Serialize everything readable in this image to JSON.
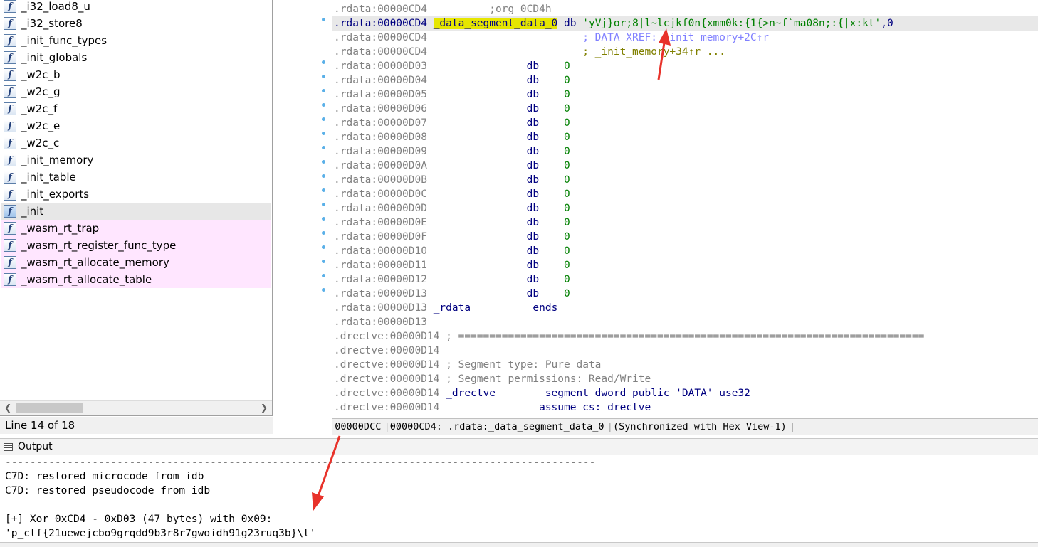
{
  "functions": {
    "items": [
      {
        "label": "_i32_load8_u",
        "style": "normal"
      },
      {
        "label": "_i32_store8",
        "style": "normal"
      },
      {
        "label": "_init_func_types",
        "style": "normal"
      },
      {
        "label": "_init_globals",
        "style": "normal"
      },
      {
        "label": "_w2c_b",
        "style": "normal"
      },
      {
        "label": "_w2c_g",
        "style": "normal"
      },
      {
        "label": "_w2c_f",
        "style": "normal"
      },
      {
        "label": "_w2c_e",
        "style": "normal"
      },
      {
        "label": "_w2c_c",
        "style": "normal"
      },
      {
        "label": "_init_memory",
        "style": "normal"
      },
      {
        "label": "_init_table",
        "style": "normal"
      },
      {
        "label": "_init_exports",
        "style": "normal"
      },
      {
        "label": "_init",
        "style": "selected"
      },
      {
        "label": "_wasm_rt_trap",
        "style": "import"
      },
      {
        "label": "_wasm_rt_register_func_type",
        "style": "import"
      },
      {
        "label": "_wasm_rt_allocate_memory",
        "style": "import"
      },
      {
        "label": "_wasm_rt_allocate_table",
        "style": "import"
      }
    ],
    "icon": "function-icon",
    "status": "Line 14 of 18"
  },
  "disasm": {
    "org_line": {
      "addr": ".rdata:00000CD4",
      "text": ";org 0CD4h"
    },
    "data_line": {
      "addr": ".rdata:00000CD4",
      "name": "_data_segment_data_0",
      "op": "db",
      "string": "'yVj}or;8|l~lcjkf0n{xmm0k:{1{>n~f`ma08n;:{|x:kt'",
      "tail": ",0"
    },
    "xref_lines": [
      {
        "addr": ".rdata:00000CD4",
        "text": "; DATA XREF: _init_memory+2C↑r"
      },
      {
        "addr": ".rdata:00000CD4",
        "text": "; _init_memory+34↑r ..."
      }
    ],
    "db_lines": [
      {
        "addr": ".rdata:00000D03",
        "op": "db",
        "val": "0"
      },
      {
        "addr": ".rdata:00000D04",
        "op": "db",
        "val": "0"
      },
      {
        "addr": ".rdata:00000D05",
        "op": "db",
        "val": "0"
      },
      {
        "addr": ".rdata:00000D06",
        "op": "db",
        "val": "0"
      },
      {
        "addr": ".rdata:00000D07",
        "op": "db",
        "val": "0"
      },
      {
        "addr": ".rdata:00000D08",
        "op": "db",
        "val": "0"
      },
      {
        "addr": ".rdata:00000D09",
        "op": "db",
        "val": "0"
      },
      {
        "addr": ".rdata:00000D0A",
        "op": "db",
        "val": "0"
      },
      {
        "addr": ".rdata:00000D0B",
        "op": "db",
        "val": "0"
      },
      {
        "addr": ".rdata:00000D0C",
        "op": "db",
        "val": "0"
      },
      {
        "addr": ".rdata:00000D0D",
        "op": "db",
        "val": "0"
      },
      {
        "addr": ".rdata:00000D0E",
        "op": "db",
        "val": "0"
      },
      {
        "addr": ".rdata:00000D0F",
        "op": "db",
        "val": "0"
      },
      {
        "addr": ".rdata:00000D10",
        "op": "db",
        "val": "0"
      },
      {
        "addr": ".rdata:00000D11",
        "op": "db",
        "val": "0"
      },
      {
        "addr": ".rdata:00000D12",
        "op": "db",
        "val": "0"
      },
      {
        "addr": ".rdata:00000D13",
        "op": "db",
        "val": "0"
      }
    ],
    "ends_line": {
      "addr": ".rdata:00000D13",
      "name": "_rdata",
      "op": "ends"
    },
    "blank_rdata": ".rdata:00000D13",
    "drectve_lines": [
      {
        "addr": ".drectve:00000D14",
        "text": "; ==========================================================================="
      },
      {
        "addr": ".drectve:00000D14",
        "text": ""
      },
      {
        "addr": ".drectve:00000D14",
        "text": "; Segment type: Pure data"
      },
      {
        "addr": ".drectve:00000D14",
        "text": "; Segment permissions: Read/Write"
      }
    ],
    "segment_line": {
      "addr": ".drectve:00000D14",
      "name": "_drectve",
      "op": "segment dword public 'DATA' use32"
    },
    "assume_line": {
      "addr": ".drectve:00000D14",
      "op": "assume cs:_drectve"
    },
    "status": {
      "offset": "00000DCC",
      "location": "00000CD4: .rdata:_data_segment_data_0",
      "sync": "(Synchronized with Hex View-1)"
    }
  },
  "output": {
    "title": "Output",
    "lines": [
      "-----------------------------------------------------------------------------------------------",
      "C7D: restored microcode from idb",
      "C7D: restored pseudocode from idb",
      "",
      "[+] Xor 0xCD4 - 0xD03 (47 bytes) with 0x09:",
      "'p_ctf{21uewejcbo9grqdd9b3r8r7gwoidh91g23ruq3b}\\t'"
    ]
  },
  "colors": {
    "highlight_name": "#e6e600",
    "annotation_arrow": "#e8322a",
    "import_row": "#ffe6ff"
  }
}
